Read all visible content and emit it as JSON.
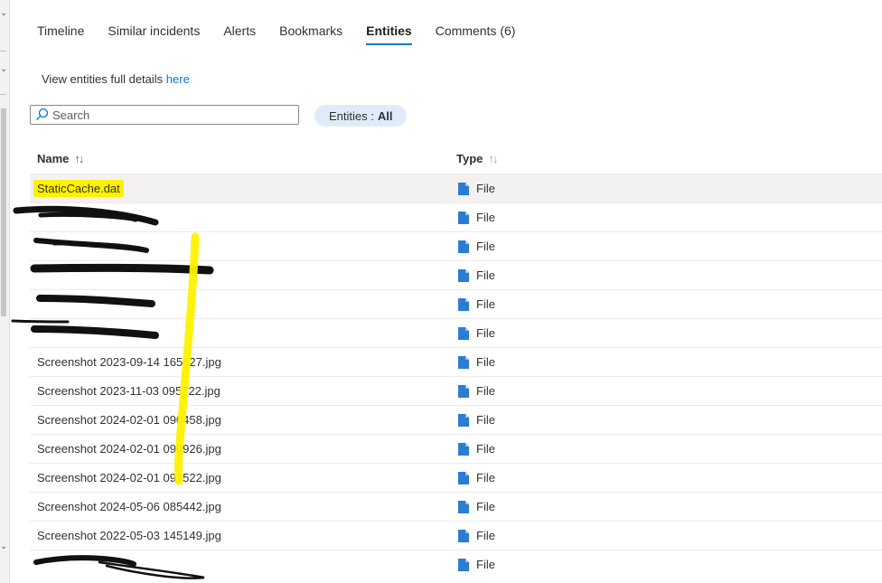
{
  "tabs": [
    {
      "label": "Timeline"
    },
    {
      "label": "Similar incidents"
    },
    {
      "label": "Alerts"
    },
    {
      "label": "Bookmarks"
    },
    {
      "label": "Entities"
    },
    {
      "label": "Comments (6)"
    }
  ],
  "active_tab": "Entities",
  "details": {
    "text": "View entities full details ",
    "link": "here"
  },
  "search": {
    "placeholder": "Search",
    "value": ""
  },
  "filter": {
    "label": "Entities : ",
    "value": "All"
  },
  "columns": {
    "name": "Name",
    "type": "Type"
  },
  "rows": [
    {
      "name": "StaticCache.dat",
      "type": "File"
    },
    {
      "name": "",
      "type": "File"
    },
    {
      "name": "",
      "type": "File"
    },
    {
      "name": "",
      "type": "File"
    },
    {
      "name": "",
      "type": "File"
    },
    {
      "name": "",
      "type": "File"
    },
    {
      "name": "Screenshot 2023-09-14 165527.jpg",
      "type": "File"
    },
    {
      "name": "Screenshot 2023-11-03 095722.jpg",
      "type": "File"
    },
    {
      "name": "Screenshot 2024-02-01 090458.jpg",
      "type": "File"
    },
    {
      "name": "Screenshot 2024-02-01 090926.jpg",
      "type": "File"
    },
    {
      "name": "Screenshot 2024-02-01 091522.jpg",
      "type": "File"
    },
    {
      "name": "Screenshot 2024-05-06 085442.jpg",
      "type": "File"
    },
    {
      "name": "Screenshot 2022-05-03 145149.jpg",
      "type": "File"
    },
    {
      "name": "",
      "type": "File"
    }
  ],
  "colors": {
    "accent": "#0078d4",
    "highlight": "#fff200",
    "file_icon": "#2b7cd3"
  },
  "icons": {
    "search": "search-icon",
    "sort": "sort-arrows-icon",
    "file": "file-icon"
  }
}
